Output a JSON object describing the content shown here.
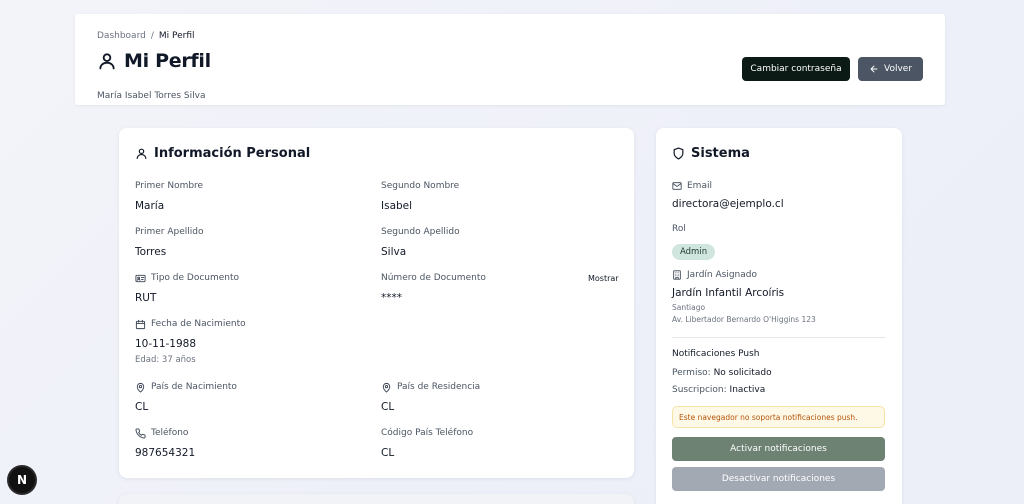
{
  "breadcrumb": {
    "parent": "Dashboard",
    "separator": "/",
    "current": "Mi Perfil"
  },
  "header": {
    "title": "Mi Perfil",
    "subtitle": "María Isabel Torres Silva",
    "change_password_label": "Cambiar contraseña",
    "back_label": "Volver",
    "icons": {
      "title": "user-icon",
      "back": "arrow-left-icon"
    }
  },
  "personal": {
    "title": "Información Personal",
    "first_name": {
      "label": "Primer Nombre",
      "value": "María"
    },
    "second_name": {
      "label": "Segundo Nombre",
      "value": "Isabel"
    },
    "first_surname": {
      "label": "Primer Apellido",
      "value": "Torres"
    },
    "second_surname": {
      "label": "Segundo Apellido",
      "value": "Silva"
    },
    "doc_type": {
      "label": "Tipo de Documento",
      "value": "RUT"
    },
    "doc_number": {
      "label": "Número de Documento",
      "value": "****",
      "toggle": "Mostrar"
    },
    "birth_date": {
      "label": "Fecha de Nacimiento",
      "value": "10-11-1988",
      "age": "Edad: 37 años"
    },
    "birth_country": {
      "label": "País de Nacimiento",
      "value": "CL"
    },
    "residence_country": {
      "label": "País de Residencia",
      "value": "CL"
    },
    "phone": {
      "label": "Teléfono",
      "value": "987654321"
    },
    "phone_code": {
      "label": "Código País Teléfono",
      "value": "CL"
    }
  },
  "system": {
    "title": "Sistema",
    "email": {
      "label": "Email",
      "value": "directora@ejemplo.cl"
    },
    "role": {
      "label": "Rol",
      "value": "Admin"
    },
    "garden": {
      "label": "Jardín Asignado",
      "name": "Jardín Infantil Arcoíris",
      "city": "Santiago",
      "address": "Av. Libertador Bernardo O'Higgins 123"
    },
    "push": {
      "title": "Notificaciones Push",
      "permission_label": "Permiso:",
      "permission_value": "No solicitado",
      "subscription_label": "Suscripcion:",
      "subscription_value": "Inactiva",
      "notice": "Este navegador no soporta notificaciones push.",
      "activate_label": "Activar notificaciones",
      "deactivate_label": "Desactivar notificaciones"
    }
  },
  "colors": {
    "primary_button": "#0b1a14",
    "secondary_button": "#4b5563",
    "badge_bg": "#cfe5dd",
    "notice_bg": "#fef9e7",
    "notice_text": "#b45309",
    "activate_button": "#6e8274",
    "deactivate_button": "#a3a9b3"
  },
  "dev_indicator": {
    "letter": "N"
  }
}
